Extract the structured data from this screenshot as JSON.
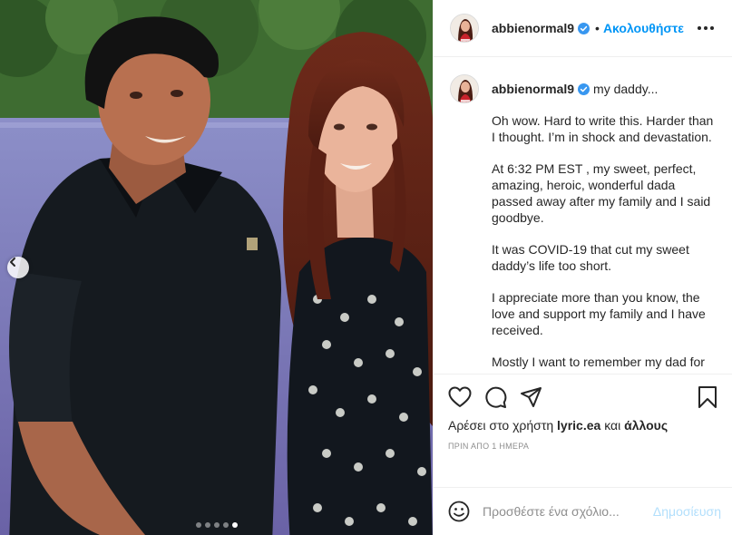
{
  "post": {
    "username": "abbienormal9",
    "follow_label": "Ακολουθήστε",
    "caption": {
      "title": "my daddy...",
      "paragraphs": [
        "Oh wow. Hard to write this. Harder than I thought. I’m in shock and devastation.",
        "At 6:32 PM EST , my sweet, perfect, amazing, heroic, wonderful dada passed away after my family and I said goodbye.",
        "It was COVID-19 that cut my sweet daddy’s life too short.",
        "I appreciate more than you know, the love and support my family and I have received.",
        "Mostly I want to remember my dad for who he was."
      ]
    },
    "likes": {
      "prefix": "Αρέσει στο χρήστη",
      "user": "lyric.ea",
      "connector": "και",
      "others": "άλλους"
    },
    "timestamp": "ΠΡΙΝ ΑΠΟ 1 ΗΜΕΡΑ",
    "comment": {
      "placeholder": "Προσθέστε ένα σχόλιο...",
      "post_label": "Δημοσίευση"
    },
    "carousel": {
      "total": 5,
      "active_index": 4
    }
  },
  "icons": [
    "chevron-left-icon",
    "verified-badge-icon",
    "more-options-icon",
    "heart-icon",
    "comment-icon",
    "share-icon",
    "bookmark-icon",
    "emoji-icon"
  ],
  "colors": {
    "accent": "#0095f6",
    "text": "#262626",
    "muted": "#8e8e8e",
    "post_disabled": "#b2dffc",
    "border": "#efefef"
  }
}
